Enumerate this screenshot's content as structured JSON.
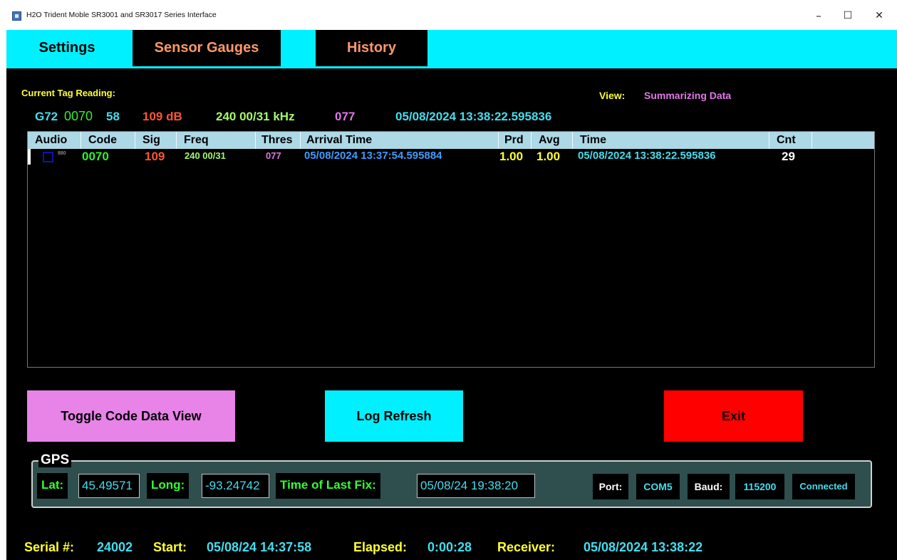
{
  "window": {
    "title": "H2O Trident Moble SR3001 and SR3017 Series Interface",
    "minimize": "–",
    "maximize": "☐",
    "close": "✕"
  },
  "tabs": {
    "settings": "Settings",
    "sensor_gauges": "Sensor Gauges",
    "history": "History"
  },
  "current": {
    "label": "Current Tag Reading:",
    "view_label": "View:",
    "view_value": "Summarizing Data",
    "prefix": "G72",
    "code": "0070",
    "num": "58",
    "signal": "109 dB",
    "freq": "240 00/31 kHz",
    "thres": "077",
    "time": "05/08/2024 13:38:22.595836"
  },
  "table": {
    "headers": {
      "audio": "Audio",
      "code": "Code",
      "sig": "Sig",
      "freq": "Freq",
      "thres": "Thres",
      "arrival": "Arrival Time",
      "prd": "Prd",
      "avg": "Avg",
      "time": "Time",
      "cnt": "Cnt"
    },
    "rows": [
      {
        "audio_tag": "880",
        "code": "0070",
        "sig": "109",
        "freq": "240 00/31",
        "thres": "077",
        "arrival": "05/08/2024 13:37:54.595884",
        "prd": "1.00",
        "avg": "1.00",
        "time": "05/08/2024 13:38:22.595836",
        "cnt": "29"
      }
    ]
  },
  "buttons": {
    "toggle": "Toggle Code Data View",
    "refresh": "Log Refresh",
    "exit": "Exit"
  },
  "gps": {
    "title": "GPS",
    "lat_label": "Lat:",
    "lat": "45.49571",
    "long_label": "Long:",
    "long": "-93.24742",
    "fix_label": "Time of Last Fix:",
    "fix": "05/08/24 19:38:20",
    "port_label": "Port:",
    "port": "COM5",
    "baud_label": "Baud:",
    "baud": "115200",
    "status": "Connected"
  },
  "status": {
    "serial_label": "Serial #:",
    "serial": "24002",
    "start_label": "Start:",
    "start": "05/08/24 14:37:58",
    "elapsed_label": "Elapsed:",
    "elapsed": "0:00:28",
    "receiver_label": "Receiver:",
    "receiver": "05/08/2024 13:38:22"
  },
  "colors": {
    "tabbar": "#00f0ff",
    "tab_text_active": "#ff9966",
    "header_row": "#add8e6",
    "toggle_button": "#e883e8",
    "refresh_button": "#00f0ff",
    "exit_button": "#ff0000",
    "gps_background": "#2f4f4f",
    "label_yellow": "#ffff33",
    "value_cyan": "#44ddee",
    "green": "#33ee33",
    "signal_red": "#ff5533",
    "thres_pink": "#e377e8"
  }
}
